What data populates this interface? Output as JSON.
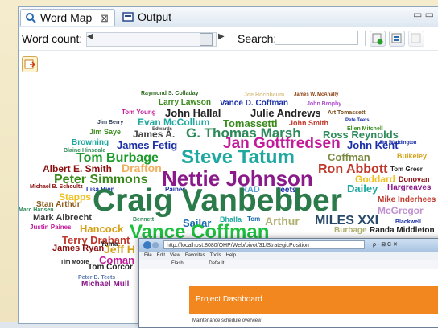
{
  "tabs": {
    "word_map": "Word Map",
    "word_map_close": "⊠",
    "output": "Output",
    "minmax": "▭ ▭"
  },
  "toolbar": {
    "word_count_label": "Word count:",
    "slider_left_arrow": "◀",
    "slider_right_arrow": "▶",
    "search_label": "Search:",
    "search_value": ""
  },
  "word_cloud": [
    {
      "text": "Raymond S. Colladay",
      "color": "#2f6b1f"
    },
    {
      "text": "Joe Hochbaum",
      "color": "#d9c48a"
    },
    {
      "text": "James W. McAnally",
      "color": "#8a3d0a"
    },
    {
      "text": "Larry Lawson",
      "color": "#3a8a1c"
    },
    {
      "text": "Vance D. Coffman",
      "color": "#1a2fa8"
    },
    {
      "text": "John Brophy",
      "color": "#b04ad0"
    },
    {
      "text": "Tom Young",
      "color": "#c21a9a"
    },
    {
      "text": "John Hallal",
      "color": "#222222"
    },
    {
      "text": "Julie Andrews",
      "color": "#222222"
    },
    {
      "text": "Art Tomassetti",
      "color": "#7a4a1a"
    },
    {
      "text": "Jim Berry",
      "color": "#2a3a55"
    },
    {
      "text": "Evan McCollum",
      "color": "#1ea8a0"
    },
    {
      "text": "Tomassetti",
      "color": "#3a8a1c"
    },
    {
      "text": "John Smith",
      "color": "#c0392b"
    },
    {
      "text": "Pete Teets",
      "color": "#1a2fa8"
    },
    {
      "text": "Edwards",
      "color": "#444444"
    },
    {
      "text": "Ellen Mitchell",
      "color": "#3a8a1c"
    },
    {
      "text": "Jim Saye",
      "color": "#3a8a1c"
    },
    {
      "text": "James A.",
      "color": "#444444"
    },
    {
      "text": "G. Thomas Marsh",
      "color": "#2e8a5a"
    },
    {
      "text": "Ross Reynolds",
      "color": "#2e8a5a"
    },
    {
      "text": "Browning",
      "color": "#1ea8a0"
    },
    {
      "text": "James Fetig",
      "color": "#1a2fa8"
    },
    {
      "text": "Jan Gottfredsen",
      "color": "#c21a9a"
    },
    {
      "text": "John Kent",
      "color": "#1a2fa8"
    },
    {
      "text": "Jim Waddington",
      "color": "#1a2fa8"
    },
    {
      "text": "Blaine Hinsdale",
      "color": "#2e8a5a"
    },
    {
      "text": "Tom Burbage",
      "color": "#1a9a2a"
    },
    {
      "text": "Steve Tatum",
      "color": "#1ea8a0"
    },
    {
      "text": "Coffman",
      "color": "#7a8a40"
    },
    {
      "text": "Bulkeley",
      "color": "#d4a017"
    },
    {
      "text": "Albert E. Smith",
      "color": "#8a1010"
    },
    {
      "text": "Drafton",
      "color": "#f0b060"
    },
    {
      "text": "Ron Abbott",
      "color": "#c0392b"
    },
    {
      "text": "Tom Greer",
      "color": "#222222"
    },
    {
      "text": "Peter Simmons",
      "color": "#3a8a1c"
    },
    {
      "text": "Nettie Johnson",
      "color": "#8a1a8a"
    },
    {
      "text": "Goddard",
      "color": "#f0c020"
    },
    {
      "text": "Donovan",
      "color": "#8a1010"
    },
    {
      "text": "Michael B. Schoultz",
      "color": "#8a1010"
    },
    {
      "text": "Lisa Bien",
      "color": "#1a2fa8"
    },
    {
      "text": "Paines",
      "color": "#1a2fa8"
    },
    {
      "text": "RAD",
      "color": "#5aa0d0"
    },
    {
      "text": "Teets",
      "color": "#1a2fa8"
    },
    {
      "text": "Dailey",
      "color": "#1ea8a0"
    },
    {
      "text": "Hargreaves",
      "color": "#8a1a8a"
    },
    {
      "text": "Stapps",
      "color": "#f0c020"
    },
    {
      "text": "Stan Arthur",
      "color": "#8a5a1a"
    },
    {
      "text": "Craig Vanbebber",
      "color": "#2a7a4a"
    },
    {
      "text": "Mike Inderhees",
      "color": "#c0392b"
    },
    {
      "text": "Marc Hansen",
      "color": "#2e8a5a"
    },
    {
      "text": "McGregor",
      "color": "#c090d0"
    },
    {
      "text": "Mark Albrecht",
      "color": "#3a3a3a"
    },
    {
      "text": "Bennett",
      "color": "#2e8a5a"
    },
    {
      "text": "Sailar",
      "color": "#1a6ab0"
    },
    {
      "text": "Bhalla",
      "color": "#1ea8a0"
    },
    {
      "text": "Tom",
      "color": "#1a6ab0"
    },
    {
      "text": "Arthur",
      "color": "#b0b070"
    },
    {
      "text": "MILES XXI",
      "color": "#2a4a6a"
    },
    {
      "text": "Blackwell",
      "color": "#1a2fa8"
    },
    {
      "text": "Justin Paines",
      "color": "#c21a9a"
    },
    {
      "text": "Hancock",
      "color": "#d4a017"
    },
    {
      "text": "Vance Coffman",
      "color": "#1ec040"
    },
    {
      "text": "Burbage",
      "color": "#b0b070"
    },
    {
      "text": "Randa Middleton",
      "color": "#222222"
    },
    {
      "text": "Terry Drabant",
      "color": "#c0392b"
    },
    {
      "text": "Yuma",
      "color": "#222222"
    },
    {
      "text": "James Ryan",
      "color": "#8a1010"
    },
    {
      "text": "Jeff H",
      "color": "#d4a017"
    },
    {
      "text": "Tim Moore",
      "color": "#222222"
    },
    {
      "text": "Coman",
      "color": "#c21a9a"
    },
    {
      "text": "Tom Corcor",
      "color": "#222222"
    },
    {
      "text": "Peter B. Teets",
      "color": "#5a7ab0"
    },
    {
      "text": "Michael Mull",
      "color": "#8a1a8a"
    }
  ],
  "browser": {
    "url": "http://localhost:8080/QHP/Web/pivot/31/StrategicPosition",
    "url_right": "ρ - ⊠ C ✕",
    "menu": [
      "File",
      "Edit",
      "View",
      "Favorites",
      "Tools",
      "Help"
    ],
    "bar2_left": "Flash",
    "bar2_right": "Default",
    "dashboard_title": "Project Dashboard",
    "dashboard_sub": "Maintenance schedule overview"
  },
  "colors": {
    "panel_border": "#8fa6bf",
    "dashboard_orange": "#f2871f",
    "tab_bg": "#dde7f1"
  }
}
